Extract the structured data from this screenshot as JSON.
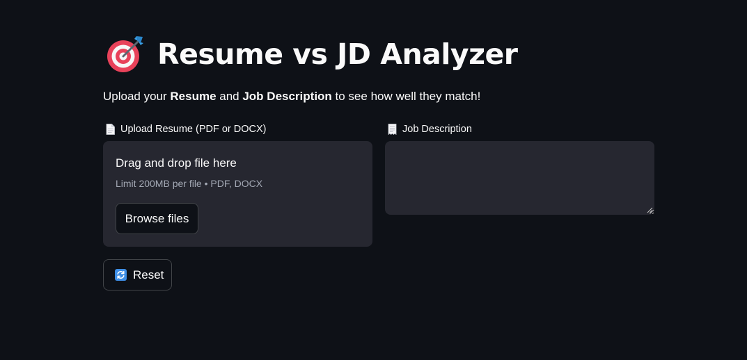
{
  "header": {
    "icon": "direct-hit-icon",
    "title": "Resume vs JD Analyzer"
  },
  "intro": {
    "prefix": "Upload your ",
    "resume_bold": "Resume",
    "middle": " and ",
    "jd_bold": "Job Description",
    "suffix": " to see how well they match!"
  },
  "resume_upload": {
    "icon": "page-icon",
    "label": "Upload Resume (PDF or DOCX)",
    "drag_text": "Drag and drop file here",
    "limit_text": "Limit 200MB per file • PDF, DOCX",
    "browse_label": "Browse files"
  },
  "job_description": {
    "icon": "receipt-icon",
    "label": "Job Description",
    "value": "",
    "placeholder": ""
  },
  "reset_button": {
    "icon": "refresh-icon",
    "label": "Reset"
  },
  "colors": {
    "background": "#0e1117",
    "surface": "#262730",
    "text": "#fafafa",
    "muted_text": "#a3a8b4",
    "target_red": "#e8425a",
    "dart_blue": "#3a9fe6"
  }
}
